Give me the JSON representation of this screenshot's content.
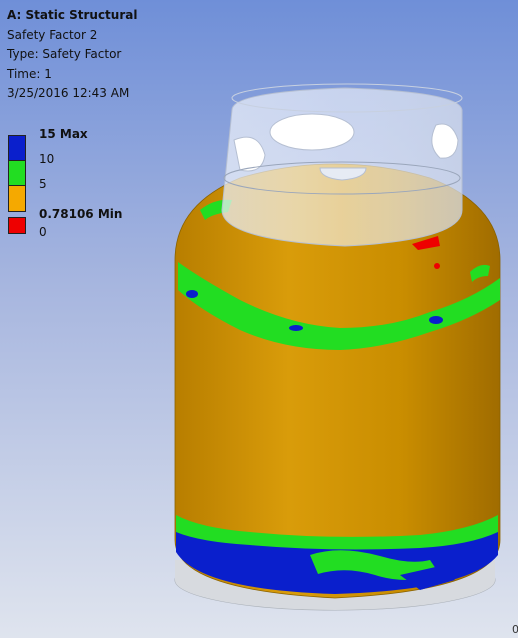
{
  "info": {
    "title": "A: Static Structural",
    "result_name": "Safety Factor 2",
    "type": "Type: Safety Factor",
    "time": "Time: 1",
    "timestamp": "3/25/2016 12:43 AM"
  },
  "legend": {
    "entries": [
      {
        "label": "15 Max",
        "color": "#0a1fcc"
      },
      {
        "label": "10",
        "color": "#22dd22"
      },
      {
        "label": "5",
        "color": "#f5a900"
      },
      {
        "label": "0.78106 Min",
        "color": "#ee0000"
      },
      {
        "label": "0"
      }
    ]
  },
  "corner_text": "0",
  "colors": {
    "tank_orange": "#d89a00",
    "band_green": "#22dd22",
    "band_blue": "#0a1fcc",
    "red": "#ee0000",
    "collar": "#dfe6f5"
  }
}
